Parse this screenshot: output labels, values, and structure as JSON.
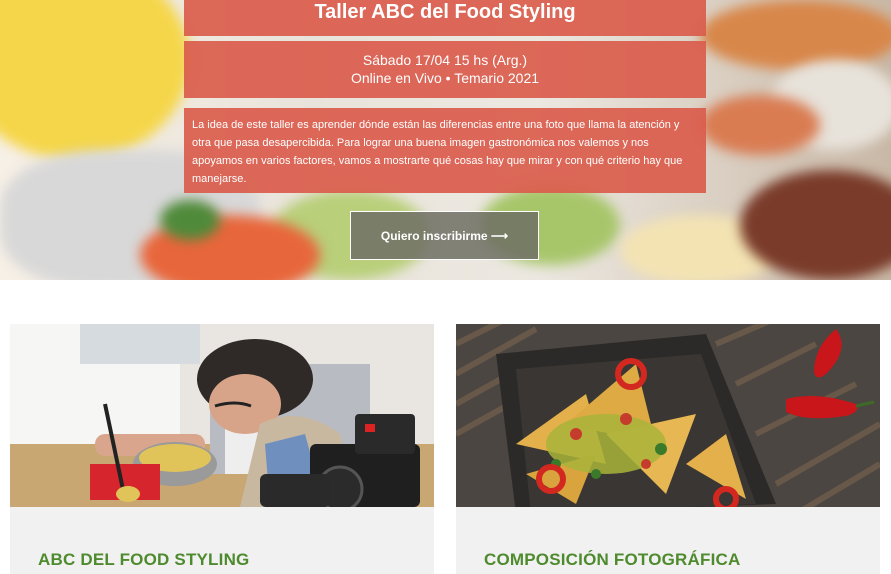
{
  "hero": {
    "title": "Taller ABC del Food Styling",
    "date_line": "Sábado 17/04 15 hs (Arg.)",
    "mode_line": "Online en Vivo • Temario 2021",
    "description": "La idea de este taller es aprender dónde están las diferencias entre una foto que llama la atención y otra que pasa desapercibida. Para lograr una buena imagen gastronómica nos valemos y nos apoyamos en varios factores, vamos a mostrarte qué cosas hay que mirar y con qué criterio hay que manejarse.",
    "cta_label": "Quiero inscribirme ⟶"
  },
  "cards": [
    {
      "title": "ABC DEL FOOD STYLING"
    },
    {
      "title": "COMPOSICIÓN FOTOGRÁFICA"
    }
  ],
  "colors": {
    "accent_panel": "#da5c4c",
    "card_title": "#4e8b2e",
    "card_bg": "#f1f1f1"
  }
}
